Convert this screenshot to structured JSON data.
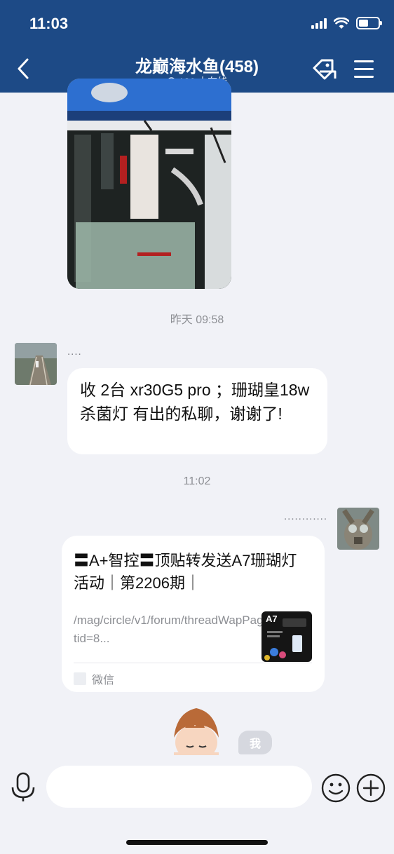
{
  "status": {
    "time": "11:03"
  },
  "header": {
    "title": "龙巅海水鱼(458)",
    "online": "186 人在线"
  },
  "messages": {
    "ts1": "昨天 09:58",
    "user1_nick": "....",
    "user1_text": "收 2台 xr30G5 pro ；珊瑚皇18w杀菌灯 有出的私聊，谢谢了!",
    "ts2": "11:02",
    "user2_nick": "............",
    "card": {
      "title": "〓A+智控〓顶贴转发送A7珊瑚灯活动｜第2206期｜",
      "url": "/mag/circle/v1/forum/threadWapPage?tid=8...",
      "thumb_label": "A7",
      "source": "微信"
    },
    "sticker_tag": "我"
  },
  "colors": {
    "header_bg": "#1d4a86",
    "chat_bg": "#f1f2f7",
    "bubble": "#ffffff"
  },
  "icons": [
    "back-icon",
    "tag-icon",
    "menu-icon",
    "mic-icon",
    "emoji-icon",
    "plus-icon"
  ]
}
